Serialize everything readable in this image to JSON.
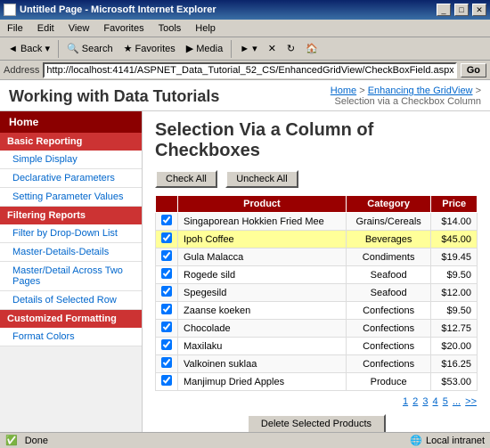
{
  "window": {
    "title": "Untitled Page - Microsoft Internet Explorer",
    "icon": "ie-icon"
  },
  "menubar": {
    "items": [
      "File",
      "Edit",
      "View",
      "Favorites",
      "Tools",
      "Help"
    ]
  },
  "toolbar": {
    "back_label": "◄ Back",
    "search_label": "Search",
    "favorites_label": "★ Favorites",
    "media_label": "Media"
  },
  "addressbar": {
    "label": "Address",
    "url": "http://localhost:4141/ASPNET_Data_Tutorial_52_CS/EnhancedGridView/CheckBoxField.aspx",
    "go_label": "Go"
  },
  "header": {
    "site_title": "Working with Data Tutorials",
    "breadcrumb": {
      "home": "Home",
      "parent": "Enhancing the GridView",
      "current": "Selection via a Checkbox Column"
    }
  },
  "sidebar": {
    "home_label": "Home",
    "sections": [
      {
        "label": "Basic Reporting",
        "items": [
          {
            "label": "Simple Display"
          },
          {
            "label": "Declarative Parameters"
          },
          {
            "label": "Setting Parameter Values"
          }
        ]
      },
      {
        "label": "Filtering Reports",
        "items": [
          {
            "label": "Filter by Drop-Down List"
          },
          {
            "label": "Master-Details-Details"
          },
          {
            "label": "Master/Detail Across Two Pages"
          },
          {
            "label": "Details of Selected Row"
          }
        ]
      },
      {
        "label": "Customized Formatting",
        "items": [
          {
            "label": "Format Colors"
          }
        ]
      }
    ]
  },
  "content": {
    "title": "Selection Via a Column of Checkboxes",
    "check_all_label": "Check All",
    "uncheck_all_label": "Uncheck All",
    "table": {
      "headers": [
        "Product",
        "Category",
        "Price"
      ],
      "rows": [
        {
          "checked": true,
          "product": "Singaporean Hokkien Fried Mee",
          "category": "Grains/Cereals",
          "price": "$14.00",
          "highlight": false
        },
        {
          "checked": true,
          "product": "Ipoh Coffee",
          "category": "Beverages",
          "price": "$45.00",
          "highlight": true
        },
        {
          "checked": true,
          "product": "Gula Malacca",
          "category": "Condiments",
          "price": "$19.45",
          "highlight": false
        },
        {
          "checked": true,
          "product": "Rogede sild",
          "category": "Seafood",
          "price": "$9.50",
          "highlight": false
        },
        {
          "checked": true,
          "product": "Spegesild",
          "category": "Seafood",
          "price": "$12.00",
          "highlight": false
        },
        {
          "checked": true,
          "product": "Zaanse koeken",
          "category": "Confections",
          "price": "$9.50",
          "highlight": false
        },
        {
          "checked": true,
          "product": "Chocolade",
          "category": "Confections",
          "price": "$12.75",
          "highlight": false
        },
        {
          "checked": true,
          "product": "Maxilaku",
          "category": "Confections",
          "price": "$20.00",
          "highlight": false
        },
        {
          "checked": true,
          "product": "Valkoinen suklaa",
          "category": "Confections",
          "price": "$16.25",
          "highlight": false
        },
        {
          "checked": true,
          "product": "Manjimup Dried Apples",
          "category": "Produce",
          "price": "$53.00",
          "highlight": false
        }
      ],
      "pagination": [
        "1",
        "2",
        "3",
        "4",
        "5",
        "...",
        ">>"
      ]
    },
    "delete_label": "Delete Selected Products"
  },
  "statusbar": {
    "status": "Done",
    "zone": "Local intranet"
  }
}
